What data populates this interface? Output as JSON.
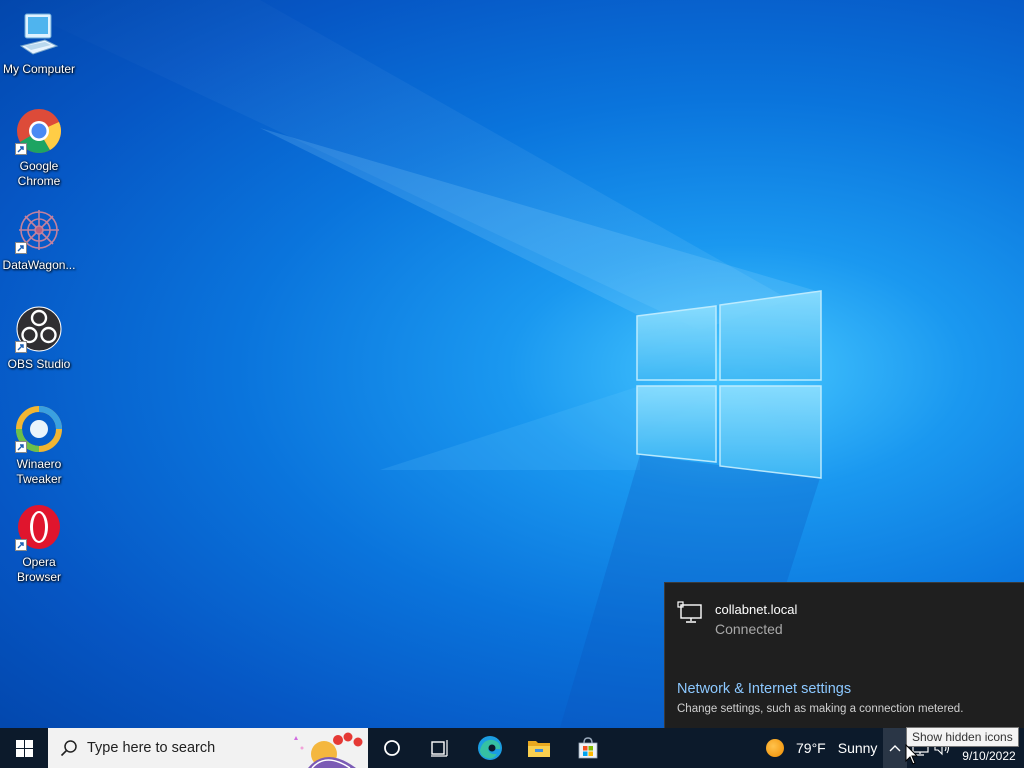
{
  "desktop": {
    "icons": [
      {
        "label": "My Computer",
        "icon": "computer-icon",
        "shortcut": false
      },
      {
        "label": "Google\nChrome",
        "icon": "chrome-icon",
        "shortcut": true
      },
      {
        "label": "DataWagon...",
        "icon": "datawagon-icon",
        "shortcut": true
      },
      {
        "label": "OBS Studio",
        "icon": "obs-icon",
        "shortcut": true
      },
      {
        "label": "Winaero\nTweaker",
        "icon": "winaero-icon",
        "shortcut": true
      },
      {
        "label": "Opera\nBrowser",
        "icon": "opera-icon",
        "shortcut": true
      }
    ]
  },
  "network_flyout": {
    "network_name": "collabnet.local",
    "status": "Connected",
    "settings_link": "Network & Internet settings",
    "settings_description": "Change settings, such as making a connection metered."
  },
  "taskbar": {
    "search_placeholder": "Type here to search",
    "pinned": [
      "cortana-icon",
      "task-view-icon",
      "edge-icon",
      "file-explorer-icon",
      "microsoft-store-icon"
    ],
    "weather": {
      "temperature": "79°F",
      "condition": "Sunny"
    },
    "clock": {
      "date": "9/10/2022"
    },
    "tooltip": "Show hidden icons"
  },
  "colors": {
    "taskbar": "#0c1a2b",
    "flyout_bg": "#1f1f1f",
    "link": "#8cc8ff",
    "desktop_accent": "#1a98f0"
  }
}
